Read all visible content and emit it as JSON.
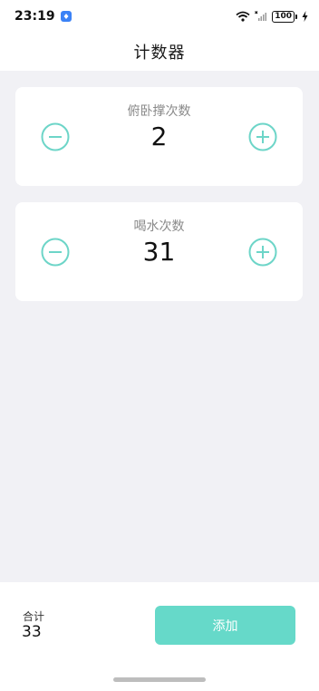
{
  "status_bar": {
    "time": "23:19",
    "battery": "100",
    "icons": [
      "app-notification-icon",
      "wifi-icon",
      "signal-icon",
      "battery-icon",
      "charging-icon"
    ]
  },
  "header": {
    "title": "计数器"
  },
  "counters": [
    {
      "label": "俯卧撑次数",
      "value": "2"
    },
    {
      "label": "喝水次数",
      "value": "31"
    }
  ],
  "footer": {
    "total_label": "合计",
    "total_value": "33",
    "add_label": "添加"
  },
  "colors": {
    "accent": "#66d9c9",
    "icon": "#6dd5c8",
    "background": "#f1f1f5"
  }
}
